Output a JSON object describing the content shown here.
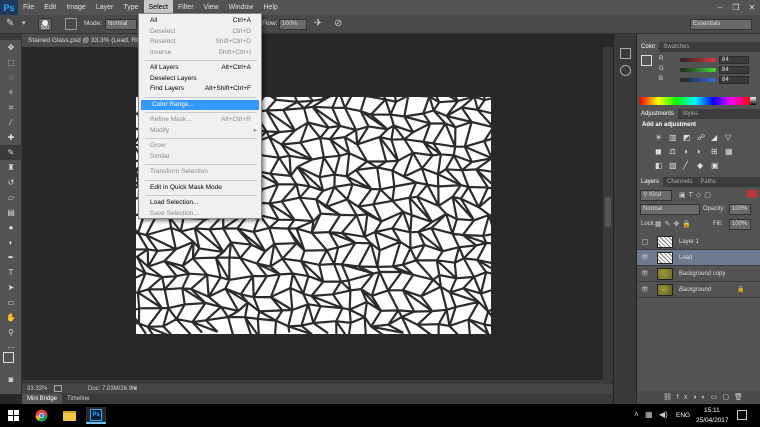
{
  "menubar": {
    "logo": "Ps",
    "items": [
      "File",
      "Edit",
      "Image",
      "Layer",
      "Type",
      "Select",
      "Filter",
      "View",
      "Window",
      "Help"
    ],
    "active": "Select"
  },
  "options": {
    "brush_size": "500",
    "mode_label": "Mode:",
    "mode_value": "Normal",
    "flow_label": "Flow:",
    "flow_value": "100%",
    "workspace": "Essentials"
  },
  "document": {
    "tab_title": "Stained Glass.psd @ 33.3% (Lead, RGB/8)",
    "zoom": "33.33%",
    "doc_size": "Doc: 7.03M/26.9M"
  },
  "bottom_tabs": [
    "Mini Bridge",
    "Timeline"
  ],
  "select_menu": [
    {
      "label": "All",
      "shortcut": "Ctrl+A",
      "enabled": true
    },
    {
      "label": "Deselect",
      "shortcut": "Ctrl+D",
      "enabled": false
    },
    {
      "label": "Reselect",
      "shortcut": "Shift+Ctrl+D",
      "enabled": false
    },
    {
      "label": "Inverse",
      "shortcut": "Shift+Ctrl+I",
      "enabled": false
    },
    {
      "sep": true
    },
    {
      "label": "All Layers",
      "shortcut": "Alt+Ctrl+A",
      "enabled": true
    },
    {
      "label": "Deselect Layers",
      "shortcut": "",
      "enabled": true
    },
    {
      "label": "Find Layers",
      "shortcut": "Alt+Shift+Ctrl+F",
      "enabled": true
    },
    {
      "sep": true
    },
    {
      "label": "Color Range...",
      "shortcut": "",
      "enabled": true,
      "highlight": true
    },
    {
      "sep": true
    },
    {
      "label": "Refine Mask...",
      "shortcut": "Alt+Ctrl+R",
      "enabled": false
    },
    {
      "label": "Modify",
      "shortcut": "",
      "enabled": false,
      "submenu": true
    },
    {
      "sep": true
    },
    {
      "label": "Grow",
      "shortcut": "",
      "enabled": false
    },
    {
      "label": "Similar",
      "shortcut": "",
      "enabled": false
    },
    {
      "sep": true
    },
    {
      "label": "Transform Selection",
      "shortcut": "",
      "enabled": false
    },
    {
      "sep": true
    },
    {
      "label": "Edit in Quick Mask Mode",
      "shortcut": "",
      "enabled": true
    },
    {
      "sep": true
    },
    {
      "label": "Load Selection...",
      "shortcut": "",
      "enabled": true
    },
    {
      "label": "Save Selection...",
      "shortcut": "",
      "enabled": false
    }
  ],
  "color_panel": {
    "tabs": [
      "Color",
      "Swatches"
    ],
    "channels": [
      {
        "name": "R",
        "value": "84",
        "color": "#e23b3b"
      },
      {
        "name": "G",
        "value": "84",
        "color": "#3be23b"
      },
      {
        "name": "B",
        "value": "84",
        "color": "#3b6be2"
      }
    ]
  },
  "adjustments_panel": {
    "tabs": [
      "Adjustments",
      "Styles"
    ],
    "heading": "Add an adjustment"
  },
  "layers_panel": {
    "tabs": [
      "Layers",
      "Channels",
      "Paths"
    ],
    "filter": "Kind",
    "blend_mode": "Normal",
    "opacity_label": "Opacity:",
    "opacity": "100%",
    "lock_label": "Lock:",
    "fill_label": "Fill:",
    "fill": "100%",
    "layers": [
      {
        "name": "Layer 1",
        "visible": false,
        "selected": false
      },
      {
        "name": "Lead",
        "visible": true,
        "selected": true
      },
      {
        "name": "Background copy",
        "visible": true,
        "selected": false
      },
      {
        "name": "Background",
        "visible": true,
        "selected": false,
        "locked": true
      }
    ]
  },
  "taskbar": {
    "language": "ENG",
    "time": "15:11",
    "date": "25/04/2017",
    "app_label": "Ps"
  }
}
